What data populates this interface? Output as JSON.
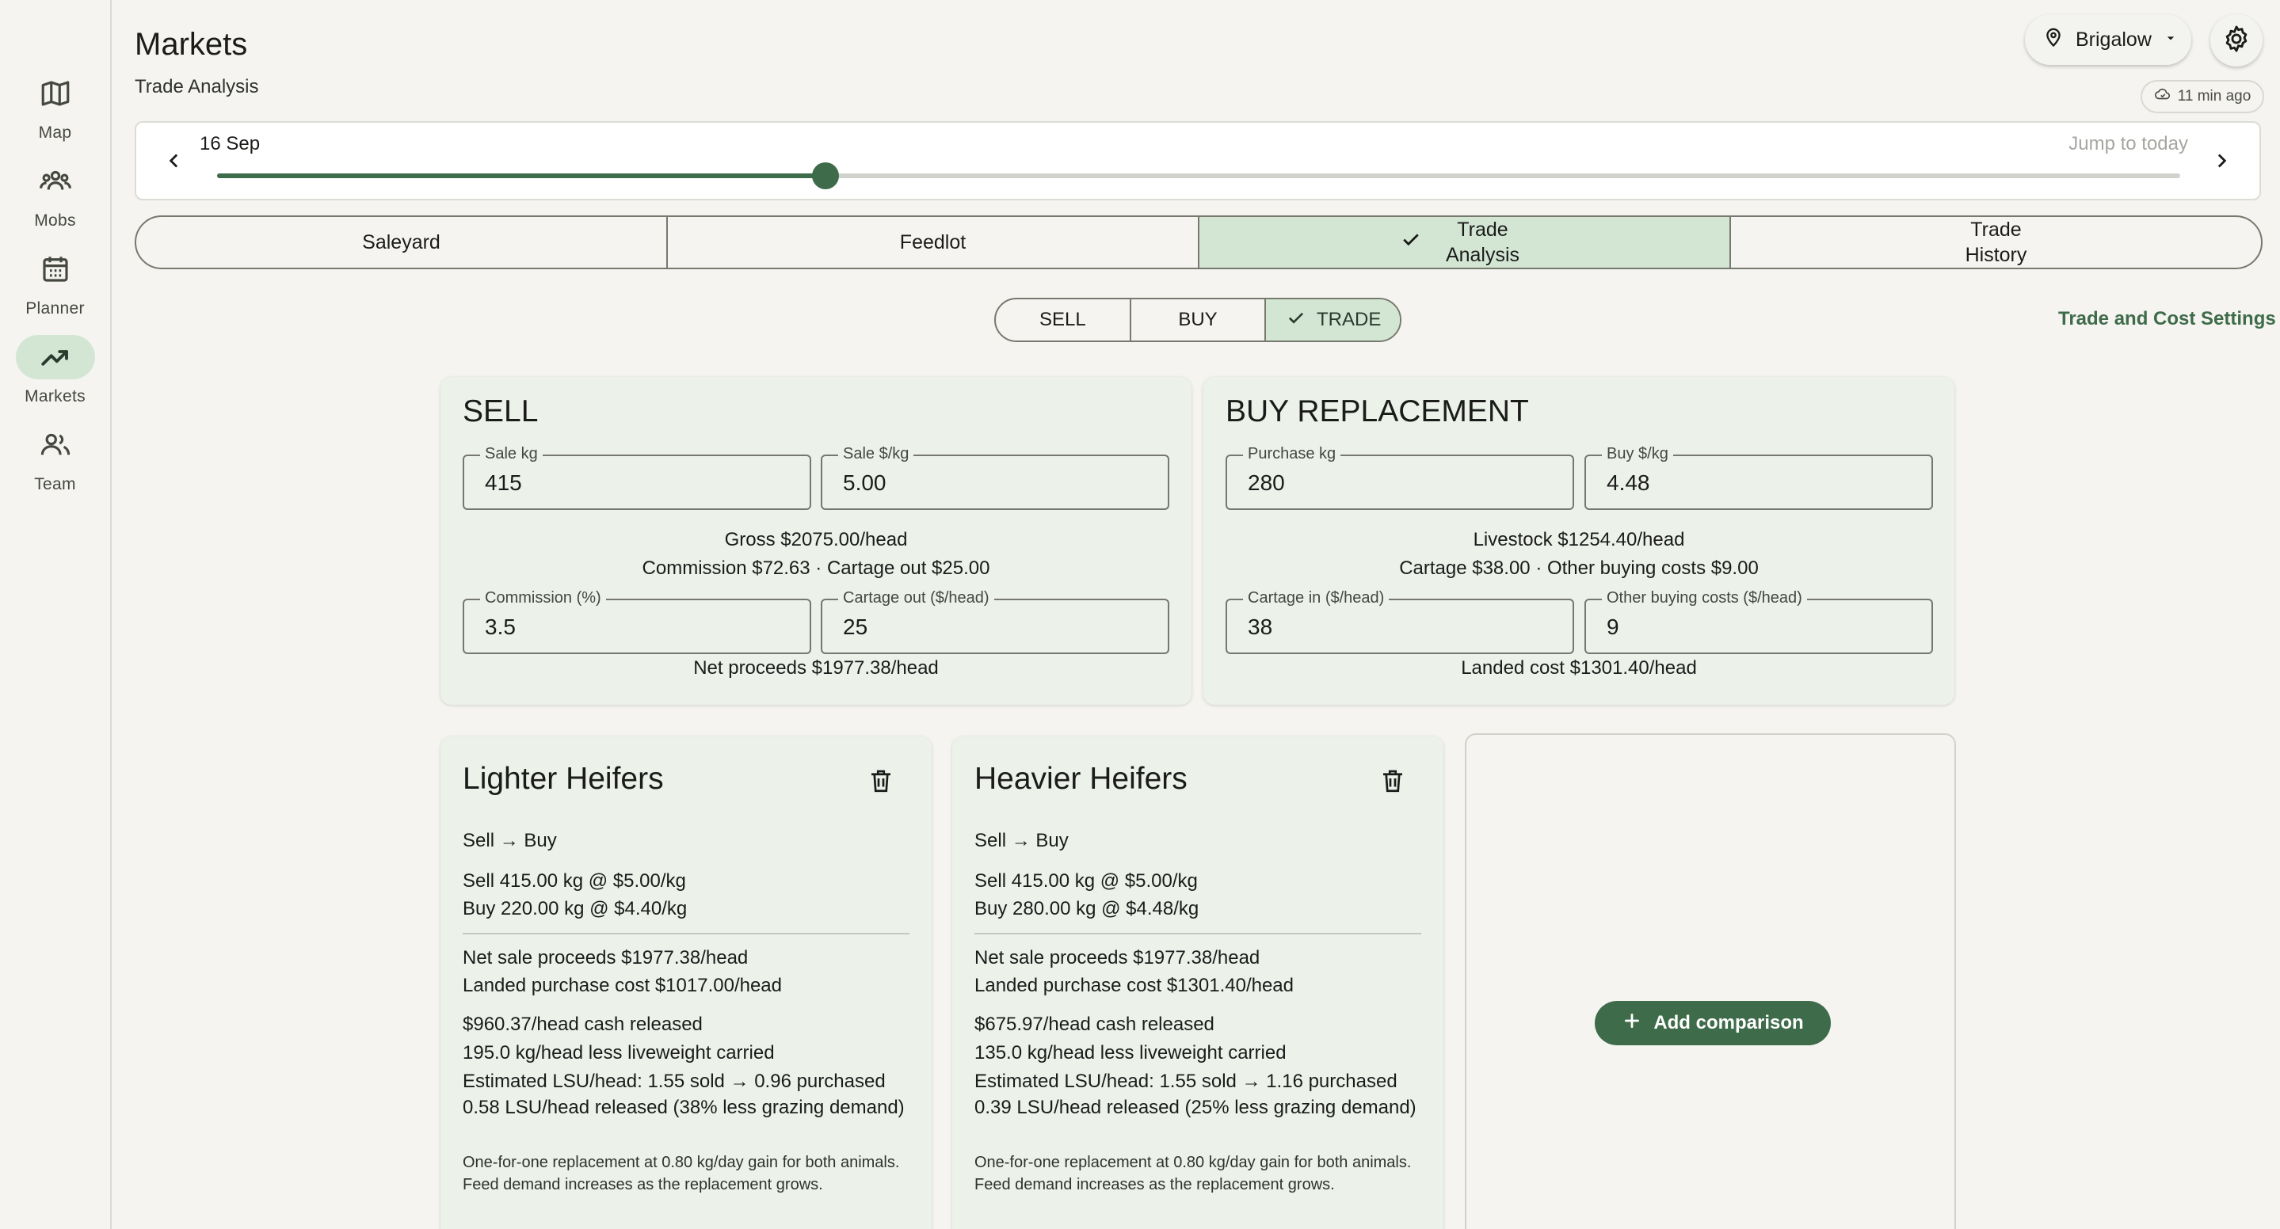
{
  "nav": {
    "items": [
      {
        "label": "Map",
        "icon": "map-icon"
      },
      {
        "label": "Mobs",
        "icon": "group-icon"
      },
      {
        "label": "Planner",
        "icon": "calendar-icon"
      },
      {
        "label": "Markets",
        "icon": "trending-up-icon",
        "active": true
      },
      {
        "label": "Team",
        "icon": "people-icon"
      }
    ]
  },
  "header": {
    "title": "Markets",
    "subtitle": "Trade Analysis",
    "location": "Brigalow",
    "sync_status": "11 min ago"
  },
  "date_slider": {
    "date_label": "16 Sep",
    "jump_label": "Jump to today",
    "position_fraction": 0.31
  },
  "tabs": [
    {
      "label": "Saleyard",
      "active": false
    },
    {
      "label": "Feedlot",
      "active": false
    },
    {
      "label": "Trade Analysis",
      "active": true
    },
    {
      "label": "Trade History",
      "active": false
    }
  ],
  "modes": [
    {
      "label": "SELL",
      "active": false
    },
    {
      "label": "BUY",
      "active": false
    },
    {
      "label": "TRADE",
      "active": true
    }
  ],
  "settings_link": "Trade and Cost Settings",
  "sell": {
    "title": "SELL",
    "sale_kg": {
      "label": "Sale kg",
      "value": "415"
    },
    "sale_price": {
      "label": "Sale $/kg",
      "value": "5.00"
    },
    "gross_line": "Gross $2075.00/head",
    "costs_line": "Commission $72.63 · Cartage out $25.00",
    "commission": {
      "label": "Commission (%)",
      "value": "3.5"
    },
    "cartage_out": {
      "label": "Cartage out ($/head)",
      "value": "25"
    },
    "net_line": "Net proceeds $1977.38/head"
  },
  "buy": {
    "title": "BUY REPLACEMENT",
    "purchase_kg": {
      "label": "Purchase kg",
      "value": "280"
    },
    "buy_price": {
      "label": "Buy $/kg",
      "value": "4.48"
    },
    "livestock_line": "Livestock $1254.40/head",
    "costs_line": "Cartage $38.00 · Other buying costs $9.00",
    "cartage_in": {
      "label": "Cartage in ($/head)",
      "value": "38"
    },
    "other_costs": {
      "label": "Other buying costs ($/head)",
      "value": "9"
    },
    "landed_line": "Landed cost $1301.40/head"
  },
  "comparisons": [
    {
      "title": "Lighter Heifers",
      "direction": "Sell → Buy",
      "sell_line": "Sell 415.00 kg @ $5.00/kg",
      "buy_line": "Buy 220.00 kg @ $4.40/kg",
      "net_sale": "Net sale proceeds $1977.38/head",
      "landed": "Landed purchase cost $1017.00/head",
      "cash": "$960.37/head cash released",
      "liveweight": "195.0 kg/head less liveweight carried",
      "lsu": "Estimated LSU/head: 1.55 sold → 0.96 purchased",
      "lsu_released": "0.58 LSU/head released (38% less grazing demand)",
      "note": "One-for-one replacement at 0.80 kg/day gain for both animals. Feed demand increases as the replacement grows."
    },
    {
      "title": "Heavier Heifers",
      "direction": "Sell → Buy",
      "sell_line": "Sell 415.00 kg @ $5.00/kg",
      "buy_line": "Buy 280.00 kg @ $4.48/kg",
      "net_sale": "Net sale proceeds $1977.38/head",
      "landed": "Landed purchase cost $1301.40/head",
      "cash": "$675.97/head cash released",
      "liveweight": "135.0 kg/head less liveweight carried",
      "lsu": "Estimated LSU/head: 1.55 sold → 1.16 purchased",
      "lsu_released": "0.39 LSU/head released (25% less grazing demand)",
      "note": "One-for-one replacement at 0.80 kg/day gain for both animals. Feed demand increases as the replacement grows."
    }
  ],
  "add_comparison_label": "Add comparison",
  "colors": {
    "accent": "#3e6b4a",
    "active_fill": "#d3e6d4",
    "panel_bg": "#ecf1ea",
    "page_bg": "#f5f4f0"
  }
}
